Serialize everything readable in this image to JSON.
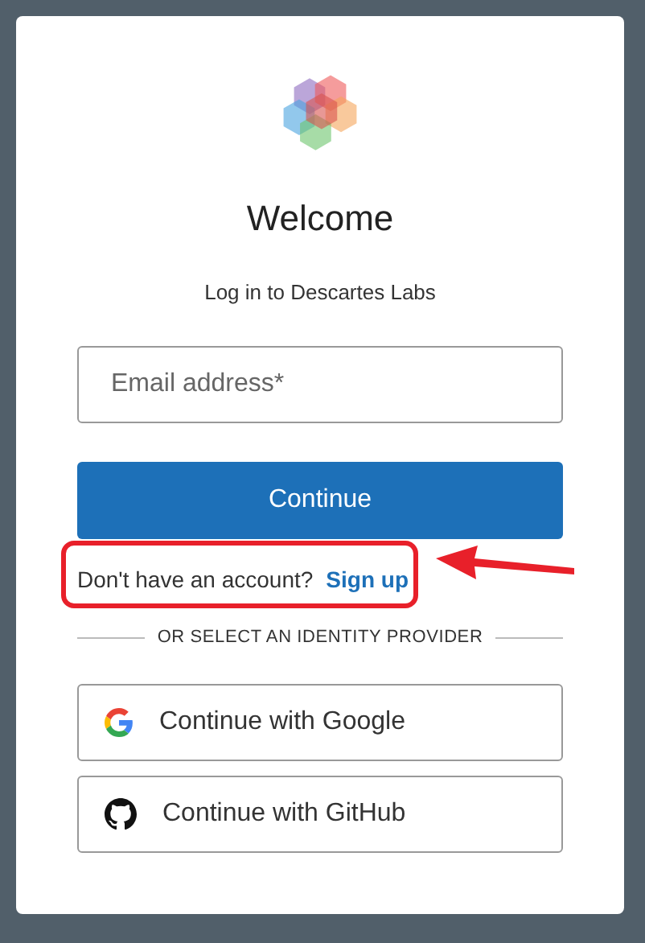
{
  "title": "Welcome",
  "subtitle": "Log in to Descartes Labs",
  "email_field": {
    "placeholder": "Email address*"
  },
  "continue_button": "Continue",
  "signup": {
    "prompt": "Don't have an account?",
    "link": "Sign up",
    "highlighted": true
  },
  "divider": "OR SELECT AN IDENTITY PROVIDER",
  "providers": [
    {
      "kind": "google",
      "label": "Continue with Google"
    },
    {
      "kind": "github",
      "label": "Continue with GitHub"
    }
  ]
}
